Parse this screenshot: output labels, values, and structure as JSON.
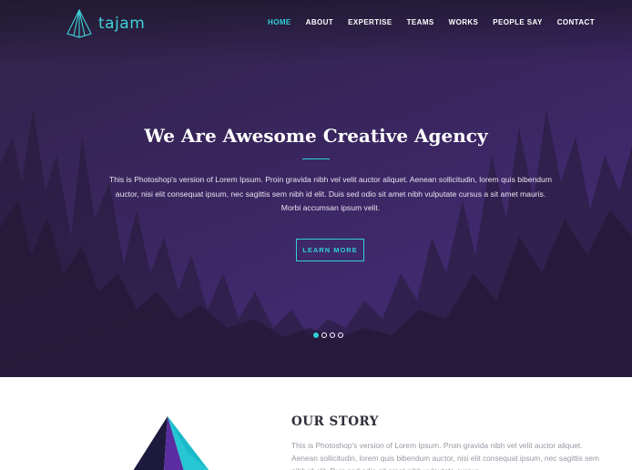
{
  "brand": {
    "name": "tajam",
    "icon": "pyramid-logo-icon"
  },
  "nav": {
    "items": [
      {
        "label": "HOME",
        "active": true
      },
      {
        "label": "ABOUT",
        "active": false
      },
      {
        "label": "EXPERTISE",
        "active": false
      },
      {
        "label": "TEAMS",
        "active": false
      },
      {
        "label": "WORKS",
        "active": false
      },
      {
        "label": "PEOPLE SAY",
        "active": false
      },
      {
        "label": "CONTACT",
        "active": false
      }
    ]
  },
  "hero": {
    "title": "We Are Awesome Creative Agency",
    "text": "This is Photoshop's version  of Lorem Ipsum. Proin gravida nibh vel velit auctor aliquet. Aenean sollicitudin, lorem quis bibendum auctor, nisi elit consequat ipsum, nec sagittis sem nibh id elit. Duis sed odio sit amet nibh vulputate cursus a sit amet mauris. Morbi accumsan ipsum velit.",
    "button_label": "LEARN MORE",
    "slides": 4,
    "active_slide": 1
  },
  "story": {
    "title": "OUR STORY",
    "text": "This is Photoshop's version  of Lorem Ipsum. Proin gravida nibh vel velit auctor aliquet. Aenean sollicitudin, lorem quis bibendum auctor, nisi elit consequat ipsum, nec sagittis sem nibh id elit. Duis sed odio sit amet nibh vulputate cursus."
  },
  "colors": {
    "accent": "#2fd0d8",
    "hero_bg": "#3a2660",
    "heading_dark": "#2f2d3a"
  }
}
